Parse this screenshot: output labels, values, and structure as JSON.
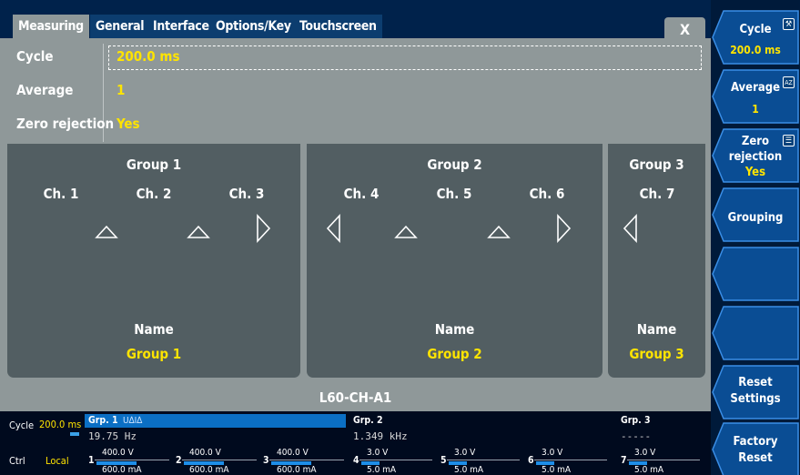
{
  "tabs": [
    {
      "label": "Measuring",
      "active": true
    },
    {
      "label": "General",
      "active": false
    },
    {
      "label": "Interface",
      "active": false
    },
    {
      "label": "Options/Key",
      "active": false
    },
    {
      "label": "Touchscreen",
      "active": false
    }
  ],
  "close_label": "X",
  "settings": {
    "cycle": {
      "label": "Cycle",
      "value": "200.0 ms"
    },
    "average": {
      "label": "Average",
      "value": "1"
    },
    "zero_rejection": {
      "label": "Zero rejection",
      "value": "Yes"
    }
  },
  "groups": [
    {
      "title": "Group 1",
      "channels": [
        "Ch. 1",
        "Ch. 2",
        "Ch. 3"
      ],
      "name_label": "Name",
      "name_value": "Group 1"
    },
    {
      "title": "Group 2",
      "channels": [
        "Ch. 4",
        "Ch. 5",
        "Ch. 6"
      ],
      "name_label": "Name",
      "name_value": "Group 2"
    },
    {
      "title": "Group 3",
      "channels": [
        "Ch. 7"
      ],
      "name_label": "Name",
      "name_value": "Group 3"
    }
  ],
  "device_name": "L60-CH-A1",
  "status": {
    "cycle_label": "Cycle",
    "cycle_value": "200.0 ms",
    "ctrl_label": "Ctrl",
    "ctrl_value": "Local",
    "grp1": {
      "title": "Grp. 1",
      "sub": "U∆I∆",
      "reading": "19.75  Hz"
    },
    "grp2": {
      "title": "Grp. 2",
      "reading": "1.349 kHz"
    },
    "grp3": {
      "title": "Grp. 3",
      "reading": "-----"
    },
    "channels": [
      {
        "num": "1",
        "voltage": "400.0 V",
        "current": "600.0 mA"
      },
      {
        "num": "2",
        "voltage": "400.0 V",
        "current": "600.0 mA"
      },
      {
        "num": "3",
        "voltage": "400.0 V",
        "current": "600.0 mA"
      },
      {
        "num": "4",
        "voltage": "3.0 V",
        "current": "5.0 mA"
      },
      {
        "num": "5",
        "voltage": "3.0 V",
        "current": "5.0 mA"
      },
      {
        "num": "6",
        "voltage": "3.0 V",
        "current": "5.0 mA"
      },
      {
        "num": "7",
        "voltage": "3.0 V",
        "current": "5.0 mA"
      }
    ]
  },
  "softkeys": {
    "cycle": {
      "label": "Cycle",
      "value": "200.0 ms",
      "icon": "tools-icon"
    },
    "average": {
      "label": "Average",
      "value": "1",
      "icon": "sort-az-icon"
    },
    "zero_rejection": {
      "label_line1": "Zero",
      "label_line2": "rejection",
      "value": "Yes",
      "icon": "list-icon"
    },
    "grouping": {
      "label": "Grouping"
    },
    "reset_settings": {
      "line1": "Reset",
      "line2": "Settings"
    },
    "factory_reset": {
      "line1": "Factory",
      "line2": "Reset"
    }
  },
  "colors": {
    "accent_yellow": "#ffe400",
    "panel_grey": "#8f9899",
    "group_dark": "#525e62",
    "navy": "#00224b",
    "bar_blue": "#1e8ee8"
  }
}
